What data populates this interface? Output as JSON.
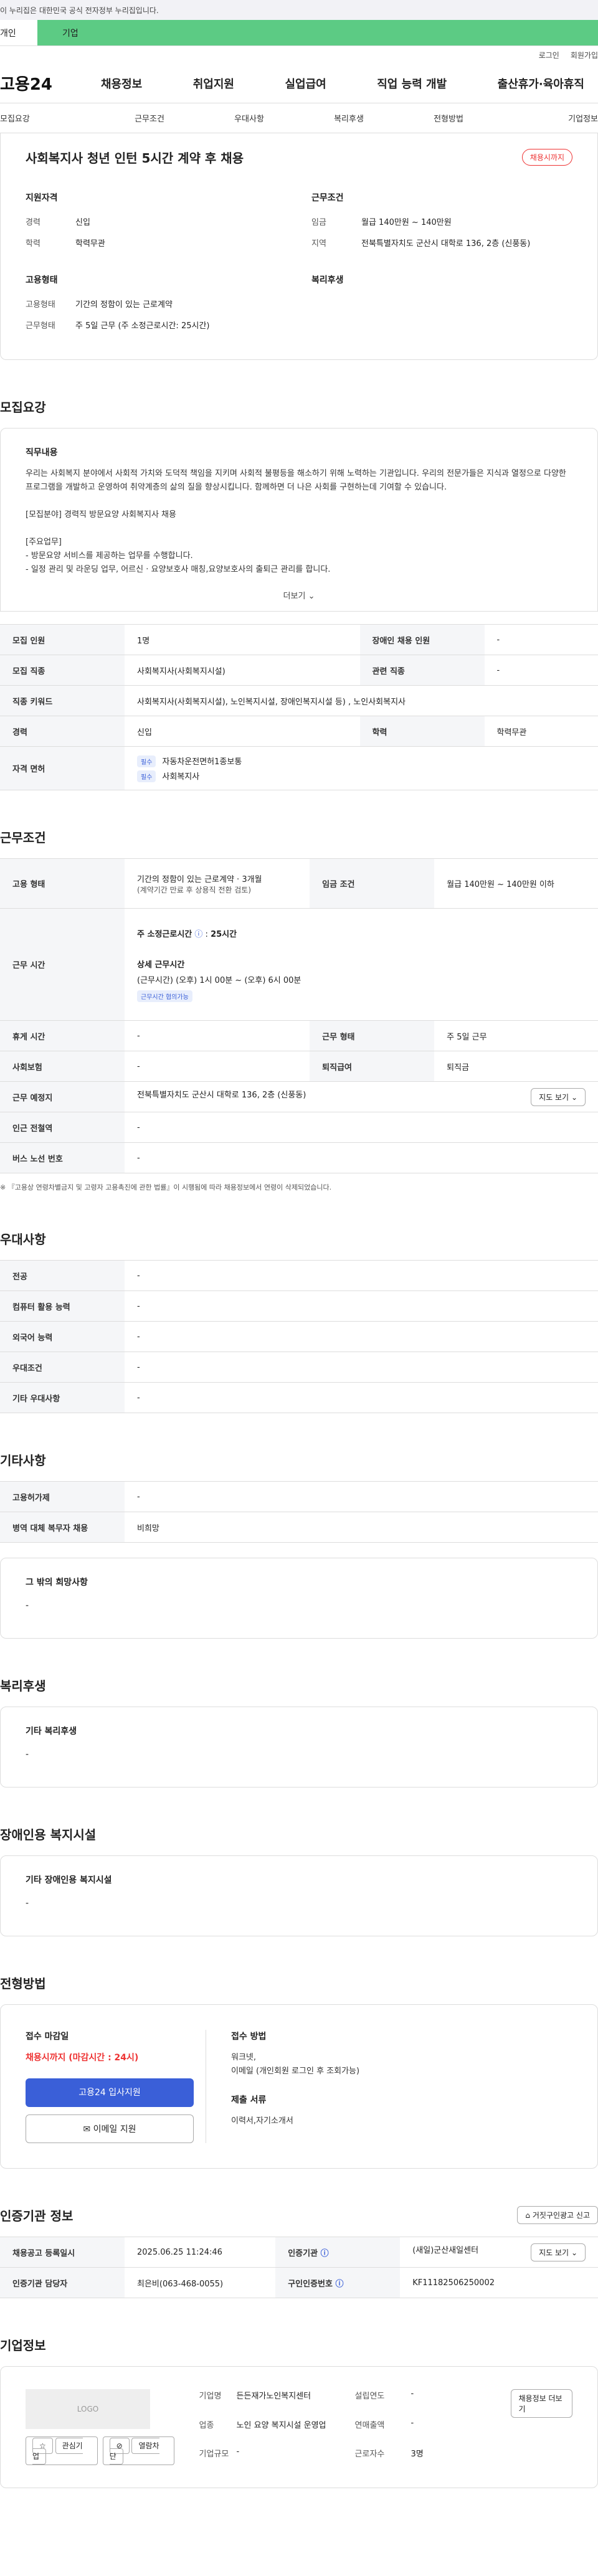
{
  "topbar": {
    "notice": "이 누리집은 대한민국 공식 전자정부 누리집입니다."
  },
  "tabs": {
    "a": "개인",
    "b": "기업"
  },
  "utility": {
    "login": "로그인",
    "join": "회원가입"
  },
  "gnb": {
    "logo": "고용24",
    "items": [
      "채용정보",
      "취업지원",
      "실업급여",
      "직업 능력 개발",
      "출산휴가·육아휴직"
    ]
  },
  "subnav": [
    "모집요강",
    "근무조건",
    "우대사항",
    "복리후생",
    "전형방법",
    "기업정보"
  ],
  "summary": {
    "title": "사회복지사 청년 인턴 5시간 계약 후 채용",
    "badge": "채용시까지",
    "qual_title": "지원자격",
    "qual": [
      {
        "k": "경력",
        "v": "신입"
      },
      {
        "k": "학력",
        "v": "학력무관"
      }
    ],
    "cond_title": "근무조건",
    "cond": [
      {
        "k": "임금",
        "v": "월급 140만원 ~ 140만원"
      },
      {
        "k": "지역",
        "v": "전북특별자치도 군산시 대학로 136, 2층 (신풍동)"
      }
    ],
    "emp_title": "고용형태",
    "emp": [
      {
        "k": "고용형태",
        "v": "기간의 정함이 있는 근로계약"
      },
      {
        "k": "근무형태",
        "v": "주 5일 근무 (주 소정근로시간: 25시간)"
      }
    ],
    "welfare_title": "복리후생"
  },
  "recruit": {
    "title": "모집요강",
    "duty_title": "직무내용",
    "duty_text": "우리는 사회복지 분야에서 사회적 가치와 도덕적 책임을 지키며 사회적 불평등을 해소하기 위해 노력하는 기관입니다. 우리의 전문가들은 지식과 열정으로 다양한 프로그램을 개발하고 운영하여 취약계층의 삶의 질을 향상시킵니다. 함께하면 더 나은 사회를 구현하는데 기여할 수 있습니다.\n\n[모집분야] 경력직 방문요양 사회복지사 채용\n\n[주요업무]\n- 방문요양 서비스를 제공하는 업무를 수행합니다.\n- 일정 관리 및 라운딩 업무, 어르신 · 요양보호사 매칭,요양보호사의 출퇴근 관리를 합니다.",
    "more": "더보기",
    "rows": [
      {
        "h1": "모집 인원",
        "v1": "1명",
        "h2": "장애인 채용 인원",
        "v2": "-"
      },
      {
        "h1": "모집 직종",
        "v1": "사회복지사(사회복지시설)",
        "h2": "관련 직종",
        "v2": "-"
      },
      {
        "h1": "직종 키워드",
        "v1": "사회복지사(사회복지시설), 노인복지시설, 장애인복지시설 등) , 노인사회복지사"
      },
      {
        "h1": "경력",
        "v1": "신입",
        "h2": "학력",
        "v2": "학력무관"
      }
    ],
    "license_h": "자격 면허",
    "license_chip": "필수",
    "licenses": [
      "자동차운전면허1종보통",
      "사회복지사"
    ]
  },
  "work": {
    "title": "근무조건",
    "emp_h": "고용 형태",
    "emp_v": "기간의 정함이 있는 근로계약 · 3개월",
    "emp_sub": "(계약기간 만료 후 상용직 전환 검토)",
    "wage_h": "임금 조건",
    "wage_v": "월급 140만원 ~ 140만원 이하",
    "hours_h": "근무 시간",
    "hours_week": "주 소정근로시간",
    "hours_week_v": "25시간",
    "hours_detail_t": "상세 근무시간",
    "hours_detail": "(근무시간) (오후) 1시 00분 ~ (오후) 6시 00분",
    "hours_chip": "근무시간 협의가능",
    "rows": [
      {
        "h1": "휴게 시간",
        "v1": "-",
        "h2": "근무 형태",
        "v2": "주 5일 근무"
      },
      {
        "h1": "사회보험",
        "v1": "-",
        "h2": "퇴직급여",
        "v2": "퇴직금"
      }
    ],
    "place_h": "근무 예정지",
    "place_v": "전북특별자치도 군산시 대학로 136, 2층 (신풍동)",
    "map_btn": "지도 보기",
    "station_h": "인근 전철역",
    "station_v": "-",
    "bus_h": "버스 노선 번호",
    "bus_v": "-",
    "note": "※ 『고용상 연령차별금지 및 고령자 고용촉진에 관한 법률』이 시행됨에 따라 채용정보에서 연령이 삭제되었습니다."
  },
  "pref": {
    "title": "우대사항",
    "rows": [
      {
        "h": "전공",
        "v": "-"
      },
      {
        "h": "컴퓨터 활용 능력",
        "v": "-"
      },
      {
        "h": "외국어 능력",
        "v": "-"
      },
      {
        "h": "우대조건",
        "v": "-"
      },
      {
        "h": "기타 우대사항",
        "v": "-"
      }
    ]
  },
  "etc": {
    "title": "기타사항",
    "rows": [
      {
        "h": "고용허가제",
        "v": "-"
      },
      {
        "h": "병역 대체 복무자 채용",
        "v": "비희망"
      }
    ],
    "wish_title": "그 밖의 희망사항",
    "wish_v": "-"
  },
  "welfare": {
    "title": "복리후생",
    "box_title": "기타 복리후생",
    "box_v": "-"
  },
  "disabled": {
    "title": "장애인용 복지시설",
    "box_title": "기타 장애인용 복지시설",
    "box_v": "-"
  },
  "apply": {
    "title": "전형방법",
    "deadline_t": "접수 마감일",
    "deadline": "채용시까지 (마감시간 : 24시)",
    "btn1": "고용24 입사지원",
    "btn2": "이메일 지원",
    "method_t": "접수 방법",
    "method_v": "워크넷,\n이메일 (개인회원 로그인 후 조회가능)",
    "docs_t": "제출 서류",
    "docs_v": "이력서,자기소개서"
  },
  "cert": {
    "title": "인증기관 정보",
    "report_btn": "거짓구인광고 신고",
    "reg_h": "채용공고 등록일시",
    "reg_v": "2025.06.25 11:24:46",
    "org_h": "인증기관",
    "org_v": "(새일)군산새일센터",
    "map_btn": "지도 보기",
    "mgr_h": "인증기관 담당자",
    "mgr_v": "최은비(063-468-0055)",
    "id_h": "구인인증번호",
    "id_v": "KF11182506250002"
  },
  "company": {
    "title": "기업정보",
    "logo": "LOGO",
    "btn_fav": "관심기업",
    "btn_block": "열람차단",
    "name_k": "기업명",
    "name_v": "든든재가노인복지센터",
    "year_k": "설립연도",
    "year_v": "-",
    "ind_k": "업종",
    "ind_v": "노인 요양 복지시설 운영업",
    "sales_k": "연매출액",
    "sales_v": "-",
    "emp_k": "근로자수",
    "emp_v": "3명",
    "size_k": "기업규모",
    "size_v": "-",
    "more_btn": "채용정보 더보기"
  }
}
